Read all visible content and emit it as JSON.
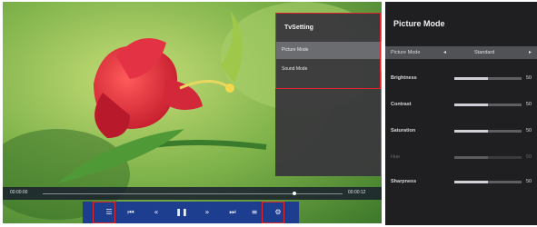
{
  "tv": {
    "settings_panel": {
      "title": "TvSetting",
      "items": [
        "Picture Mode",
        "Sound Mode"
      ],
      "active_index": 0
    },
    "player": {
      "elapsed": "00:00:00",
      "total": "00:00:12",
      "progress_fraction": 0.84,
      "controls": [
        {
          "name": "playlist-icon",
          "glyph": "☰"
        },
        {
          "name": "skip-previous-icon",
          "glyph": "⏮"
        },
        {
          "name": "rewind-icon",
          "glyph": "«"
        },
        {
          "name": "pause-icon",
          "glyph": "❚❚"
        },
        {
          "name": "fast-forward-icon",
          "glyph": "»"
        },
        {
          "name": "skip-next-icon",
          "glyph": "⏭"
        },
        {
          "name": "list-icon",
          "glyph": "≡"
        },
        {
          "name": "settings-icon",
          "glyph": "⚙"
        }
      ]
    },
    "highlight_color": "#e0262c"
  },
  "picture_mode": {
    "title": "Picture Mode",
    "mode_label": "Picture Mode",
    "mode_value": "Standard",
    "left_arrow": "◂",
    "right_arrow": "▸",
    "sliders": [
      {
        "label": "Brightness",
        "value": "50",
        "level": 0.5,
        "enabled": true
      },
      {
        "label": "Contrast",
        "value": "50",
        "level": 0.5,
        "enabled": true
      },
      {
        "label": "Saturation",
        "value": "50",
        "level": 0.5,
        "enabled": true
      },
      {
        "label": "Hue",
        "value": "50",
        "level": 0.5,
        "enabled": false
      },
      {
        "label": "Sharpness",
        "value": "50",
        "level": 0.5,
        "enabled": true
      }
    ]
  }
}
